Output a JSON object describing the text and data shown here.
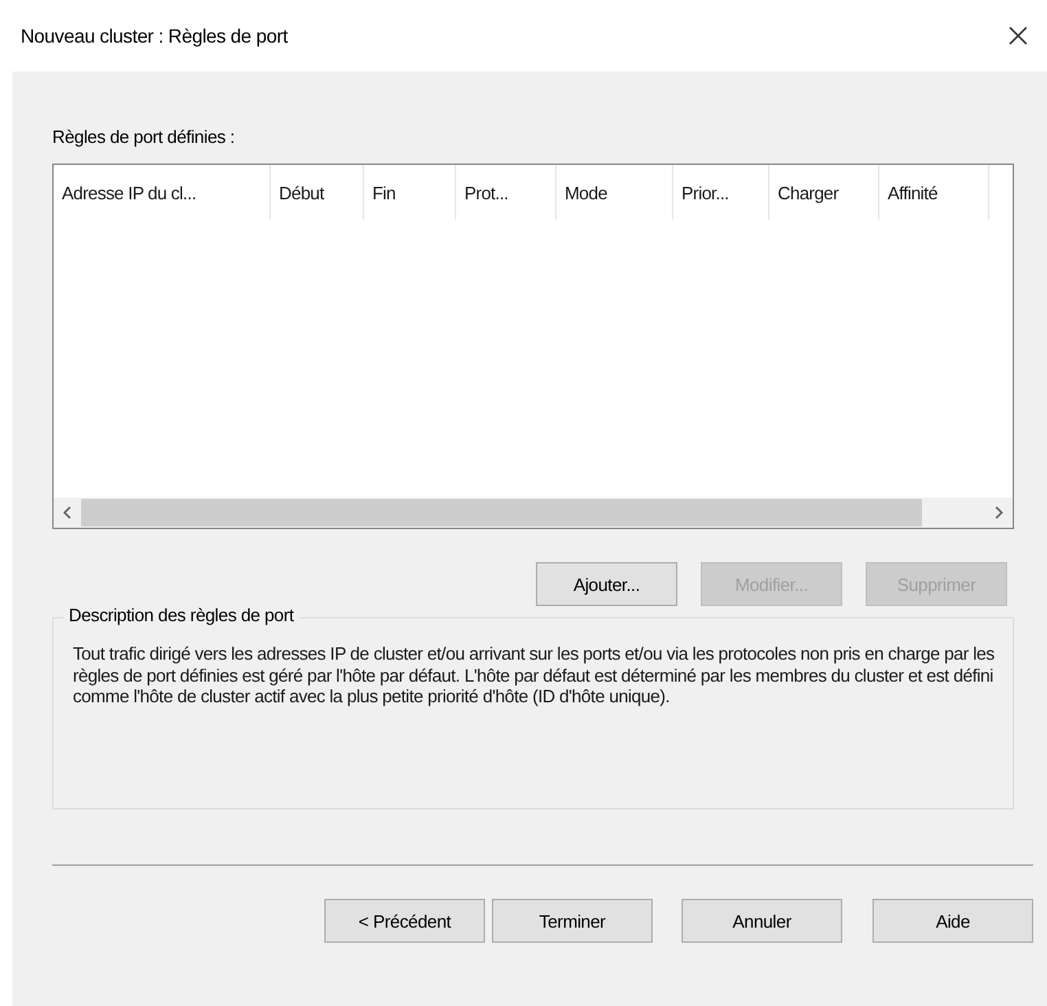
{
  "window": {
    "title": "Nouveau cluster : Règles de port"
  },
  "rules_label": "Règles de port définies :",
  "list": {
    "columns": [
      "Adresse IP du cl...",
      "Début",
      "Fin",
      "Prot...",
      "Mode",
      "Prior...",
      "Charger",
      "Affinité"
    ]
  },
  "list_buttons": [
    {
      "label": "Ajouter...",
      "disabled": false
    },
    {
      "label": "Modifier...",
      "disabled": true
    },
    {
      "label": "Supprimer",
      "disabled": true
    }
  ],
  "description": {
    "title": "Description des règles de port",
    "text": "Tout trafic dirigé vers les adresses IP de cluster et/ou arrivant sur les ports et/ou via les protocoles non pris en charge par les règles de port définies est géré par l'hôte par défaut. L'hôte par défaut est déterminé par les membres du cluster et est défini comme l'hôte de cluster actif avec la plus petite priorité d'hôte (ID d'hôte unique)."
  },
  "footer_buttons": [
    {
      "label": "< Précédent",
      "disabled": false
    },
    {
      "label": "Terminer",
      "disabled": false
    },
    {
      "label": "Annuler",
      "disabled": false
    },
    {
      "label": "Aide",
      "disabled": false
    }
  ]
}
